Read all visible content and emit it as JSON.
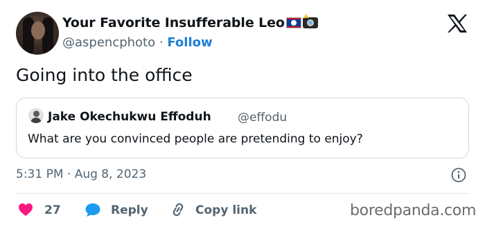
{
  "author": {
    "display_name": "Your Favorite Insufferable Leo",
    "handle": "@aspencphoto",
    "separator": "·",
    "follow_label": "Follow",
    "avatar_icon": "profile-photo",
    "emoji_icons": [
      "belize-flag-icon",
      "camera-with-flash-icon"
    ]
  },
  "brand_icon": "x-logo-icon",
  "tweet": {
    "text": "Going into the office"
  },
  "quoted_tweet": {
    "author_name": "Jake Okechukwu Effoduh",
    "author_handle": "@effodu",
    "text": "What are you convinced people are pretending to enjoy?"
  },
  "meta": {
    "timestamp": "5:31 PM · Aug 8, 2023"
  },
  "actions": {
    "like_count": "27",
    "reply_label": "Reply",
    "copy_link_label": "Copy link"
  },
  "watermark": {
    "text": "boredpanda.com"
  },
  "colors": {
    "text": "#0f1419",
    "secondary": "#536471",
    "follow": "#1d7fd6",
    "like": "#f91880",
    "reply": "#1d9bf0",
    "border": "#cfd9de"
  }
}
